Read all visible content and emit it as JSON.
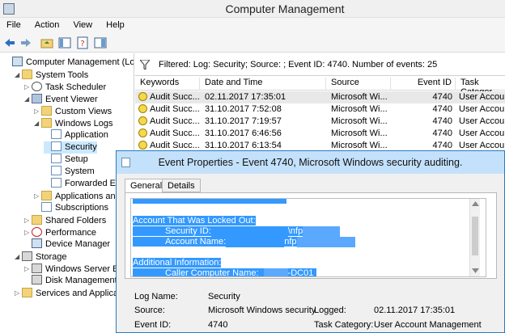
{
  "window": {
    "title": "Computer Management"
  },
  "menu": [
    "File",
    "Action",
    "View",
    "Help"
  ],
  "tree": [
    {
      "label": "Computer Management (Local",
      "indent": 0,
      "arrow": "",
      "icon": "pc"
    },
    {
      "label": "System Tools",
      "indent": 1,
      "arrow": "◢",
      "icon": "folder"
    },
    {
      "label": "Task Scheduler",
      "indent": 2,
      "arrow": "▷",
      "icon": "clock"
    },
    {
      "label": "Event Viewer",
      "indent": 2,
      "arrow": "◢",
      "icon": "ev"
    },
    {
      "label": "Custom Views",
      "indent": 3,
      "arrow": "▷",
      "icon": "folder"
    },
    {
      "label": "Windows Logs",
      "indent": 3,
      "arrow": "◢",
      "icon": "folder"
    },
    {
      "label": "Application",
      "indent": 4,
      "arrow": "",
      "icon": "log"
    },
    {
      "label": "Security",
      "indent": 4,
      "arrow": "",
      "icon": "log",
      "selected": true
    },
    {
      "label": "Setup",
      "indent": 4,
      "arrow": "",
      "icon": "log"
    },
    {
      "label": "System",
      "indent": 4,
      "arrow": "",
      "icon": "log"
    },
    {
      "label": "Forwarded E",
      "indent": 4,
      "arrow": "",
      "icon": "log"
    },
    {
      "label": "Applications an",
      "indent": 3,
      "arrow": "▷",
      "icon": "folder"
    },
    {
      "label": "Subscriptions",
      "indent": 3,
      "arrow": "",
      "icon": "log"
    },
    {
      "label": "Shared Folders",
      "indent": 2,
      "arrow": "▷",
      "icon": "folder"
    },
    {
      "label": "Performance",
      "indent": 2,
      "arrow": "▷",
      "icon": "red"
    },
    {
      "label": "Device Manager",
      "indent": 2,
      "arrow": "",
      "icon": "pc"
    },
    {
      "label": "Storage",
      "indent": 1,
      "arrow": "◢",
      "icon": "disk"
    },
    {
      "label": "Windows Server Bac",
      "indent": 2,
      "arrow": "▷",
      "icon": "disk"
    },
    {
      "label": "Disk Management",
      "indent": 2,
      "arrow": "",
      "icon": "disk"
    },
    {
      "label": "Services and Applicatio",
      "indent": 1,
      "arrow": "▷",
      "icon": "folder"
    }
  ],
  "filter": {
    "text": "Filtered: Log: Security; Source: ; Event ID: 4740. Number of events: 25"
  },
  "grid": {
    "columns": [
      "Keywords",
      "Date and Time",
      "Source",
      "Event ID",
      "Task Categor"
    ],
    "rows": [
      [
        "Audit Succ...",
        "02.11.2017 17:35:01",
        "Microsoft Wi...",
        "4740",
        "User Account"
      ],
      [
        "Audit Succ...",
        "31.10.2017 7:52:08",
        "Microsoft Wi...",
        "4740",
        "User Account"
      ],
      [
        "Audit Succ...",
        "31.10.2017 7:19:57",
        "Microsoft Wi...",
        "4740",
        "User Account"
      ],
      [
        "Audit Succ...",
        "31.10.2017 6:46:56",
        "Microsoft Wi...",
        "4740",
        "User Account"
      ],
      [
        "Audit Succ...",
        "31.10.2017 6:13:54",
        "Microsoft Wi...",
        "4740",
        "User Account"
      ]
    ]
  },
  "dialog": {
    "title": "Event Properties - Event 4740, Microsoft Windows security auditing.",
    "tabs": [
      "General",
      "Details"
    ],
    "desc": {
      "locked_header": "Account That Was Locked Out:",
      "security_id_label": "Security ID:",
      "security_id_value": "\\nfp",
      "account_name_label": "Account Name:",
      "account_name_value": "nfp",
      "additional_header": "Additional Information:",
      "caller_label": "Caller Computer Name:",
      "caller_value": "-DC01"
    },
    "props": {
      "log_name_label": "Log Name:",
      "log_name_value": "Security",
      "source_label": "Source:",
      "source_value": "Microsoft Windows security",
      "logged_label": "Logged:",
      "logged_value": "02.11.2017 17:35:01",
      "event_id_label": "Event ID:",
      "event_id_value": "4740",
      "task_label": "Task Category:",
      "task_value": "User Account Management"
    }
  }
}
